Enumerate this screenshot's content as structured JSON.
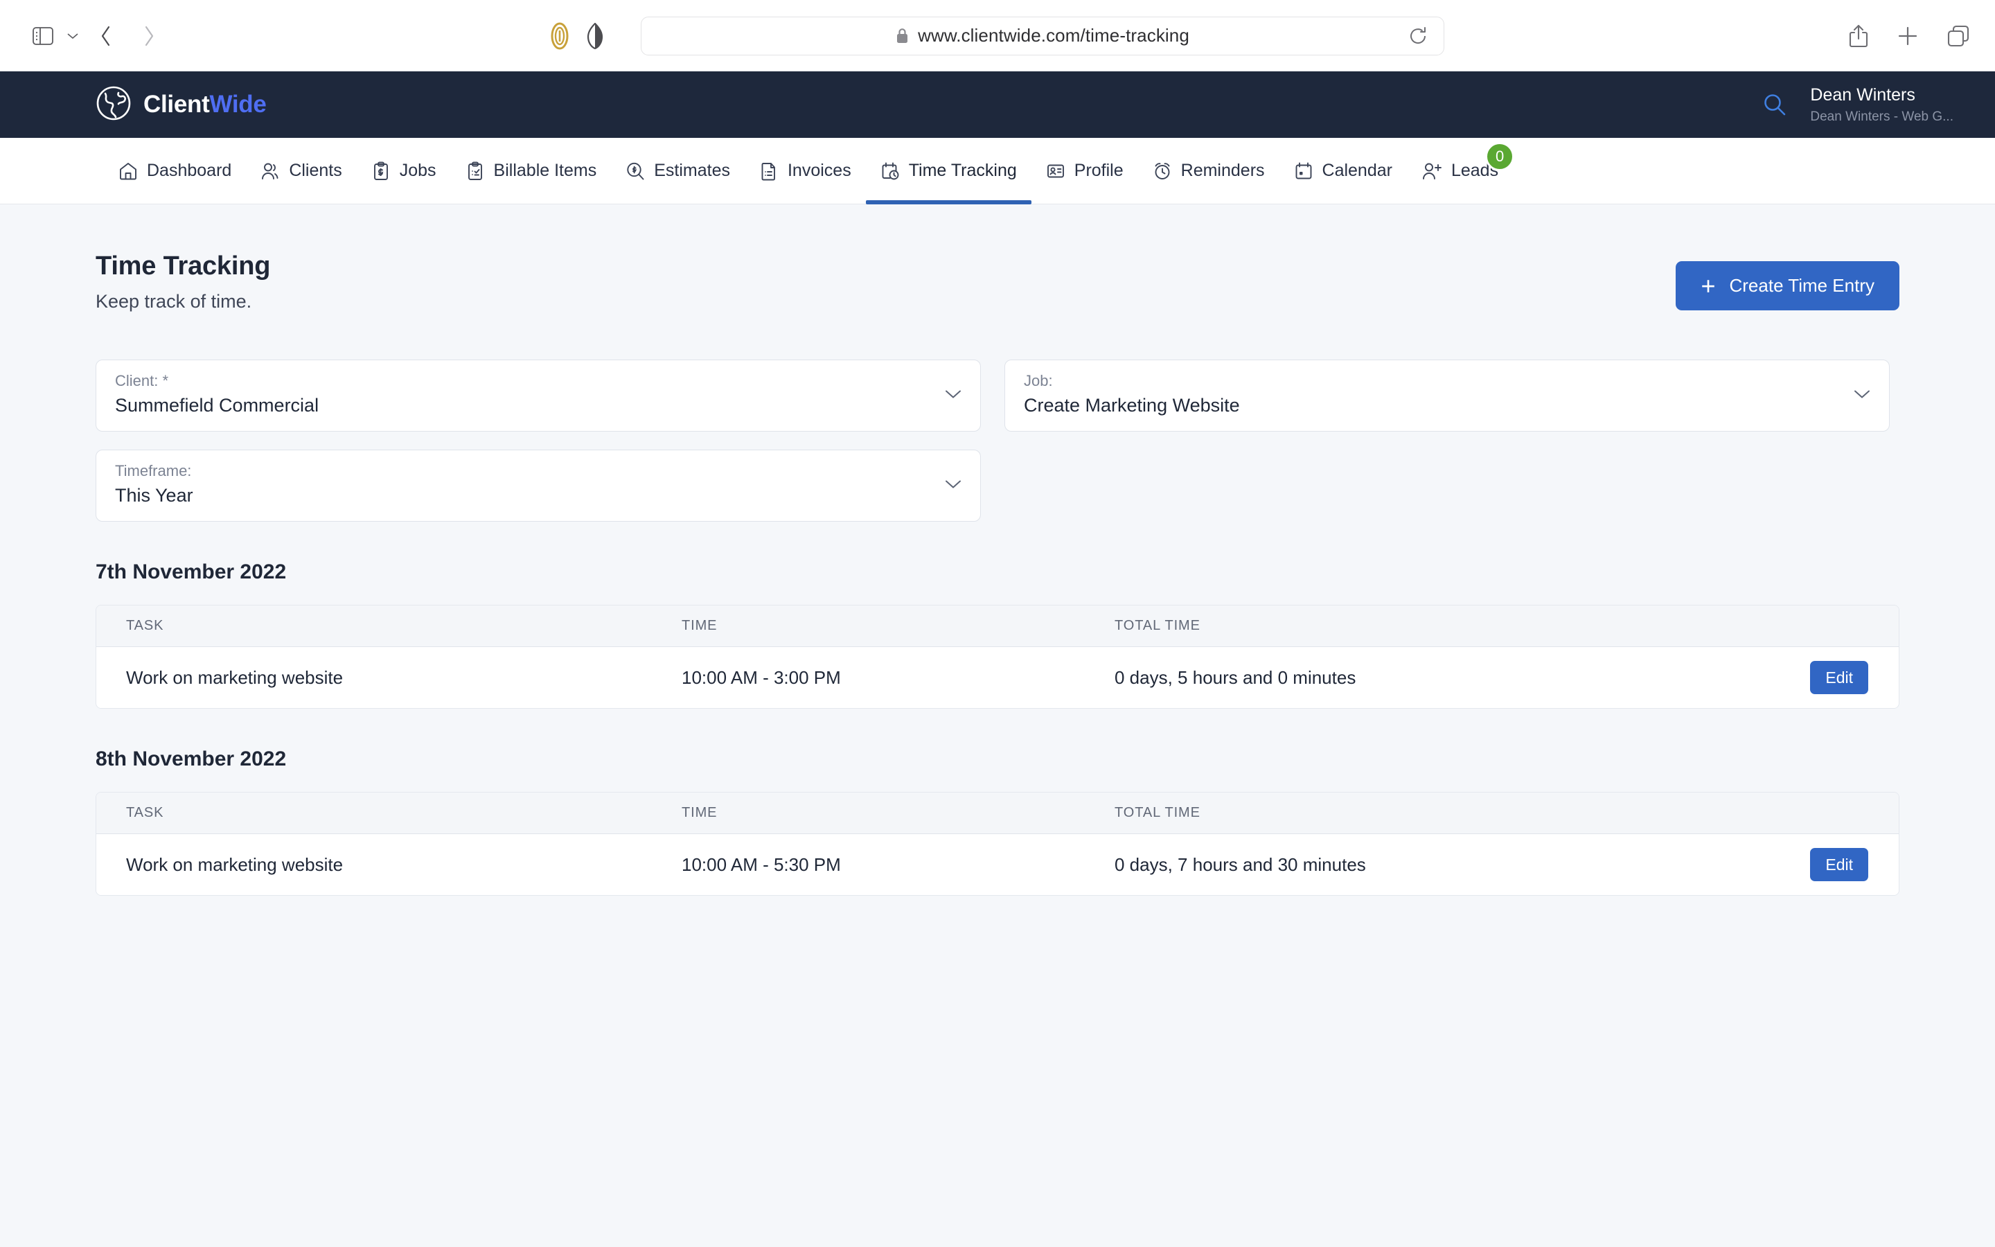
{
  "browser": {
    "url": "www.clientwide.com/time-tracking",
    "icons": {
      "sidebar": "sidebar-toggle-icon",
      "chevron": "chevron-down-icon",
      "back": "back-arrow-icon",
      "forward": "forward-arrow-icon",
      "extension": "extension-icon",
      "privacy": "privacy-shield-icon",
      "lock": "lock-icon",
      "reload": "reload-icon",
      "share": "share-icon",
      "new_tab": "plus-icon",
      "tabs": "tab-overview-icon"
    }
  },
  "header": {
    "logo_primary": "Client",
    "logo_secondary": "Wide",
    "search_icon": "search-icon",
    "user_name": "Dean Winters",
    "user_subtitle": "Dean Winters - Web G...",
    "background": "#1e283c",
    "accent": "#4f6ef2"
  },
  "nav": {
    "items": [
      {
        "label": "Dashboard",
        "icon": "home-icon",
        "active": false
      },
      {
        "label": "Clients",
        "icon": "users-icon",
        "active": false
      },
      {
        "label": "Jobs",
        "icon": "clipboard-dollar-icon",
        "active": false
      },
      {
        "label": "Billable Items",
        "icon": "clipboard-check-icon",
        "active": false
      },
      {
        "label": "Estimates",
        "icon": "magnifier-dollar-icon",
        "active": false
      },
      {
        "label": "Invoices",
        "icon": "document-icon",
        "active": false
      },
      {
        "label": "Time Tracking",
        "icon": "calendar-clock-icon",
        "active": true
      },
      {
        "label": "Profile",
        "icon": "id-card-icon",
        "active": false
      },
      {
        "label": "Reminders",
        "icon": "alarm-clock-icon",
        "active": false
      },
      {
        "label": "Calendar",
        "icon": "calendar-icon",
        "active": false
      },
      {
        "label": "Leads",
        "icon": "user-plus-icon",
        "active": false,
        "badge": "0"
      }
    ],
    "active_color": "#2f62b3",
    "badge_color": "#5aa832"
  },
  "page": {
    "title": "Time Tracking",
    "subtitle": "Keep track of time.",
    "create_button": "Create Time Entry",
    "create_button_color": "#3166c4"
  },
  "filters": [
    {
      "label": "Client: *",
      "value": "Summefield Commercial",
      "name": "client-select"
    },
    {
      "label": "Job:",
      "value": "Create Marketing Website",
      "name": "job-select"
    },
    {
      "label": "Timeframe:",
      "value": "This Year",
      "name": "timeframe-select"
    }
  ],
  "table": {
    "columns": [
      "TASK",
      "TIME",
      "TOTAL TIME"
    ],
    "edit_label": "Edit"
  },
  "groups": [
    {
      "date": "7th November 2022",
      "rows": [
        {
          "task": "Work on marketing website",
          "time": "10:00 AM - 3:00 PM",
          "total": "0 days, 5 hours and 0 minutes"
        }
      ]
    },
    {
      "date": "8th November 2022",
      "rows": [
        {
          "task": "Work on marketing website",
          "time": "10:00 AM - 5:30 PM",
          "total": "0 days, 7 hours and 30 minutes"
        }
      ]
    }
  ]
}
